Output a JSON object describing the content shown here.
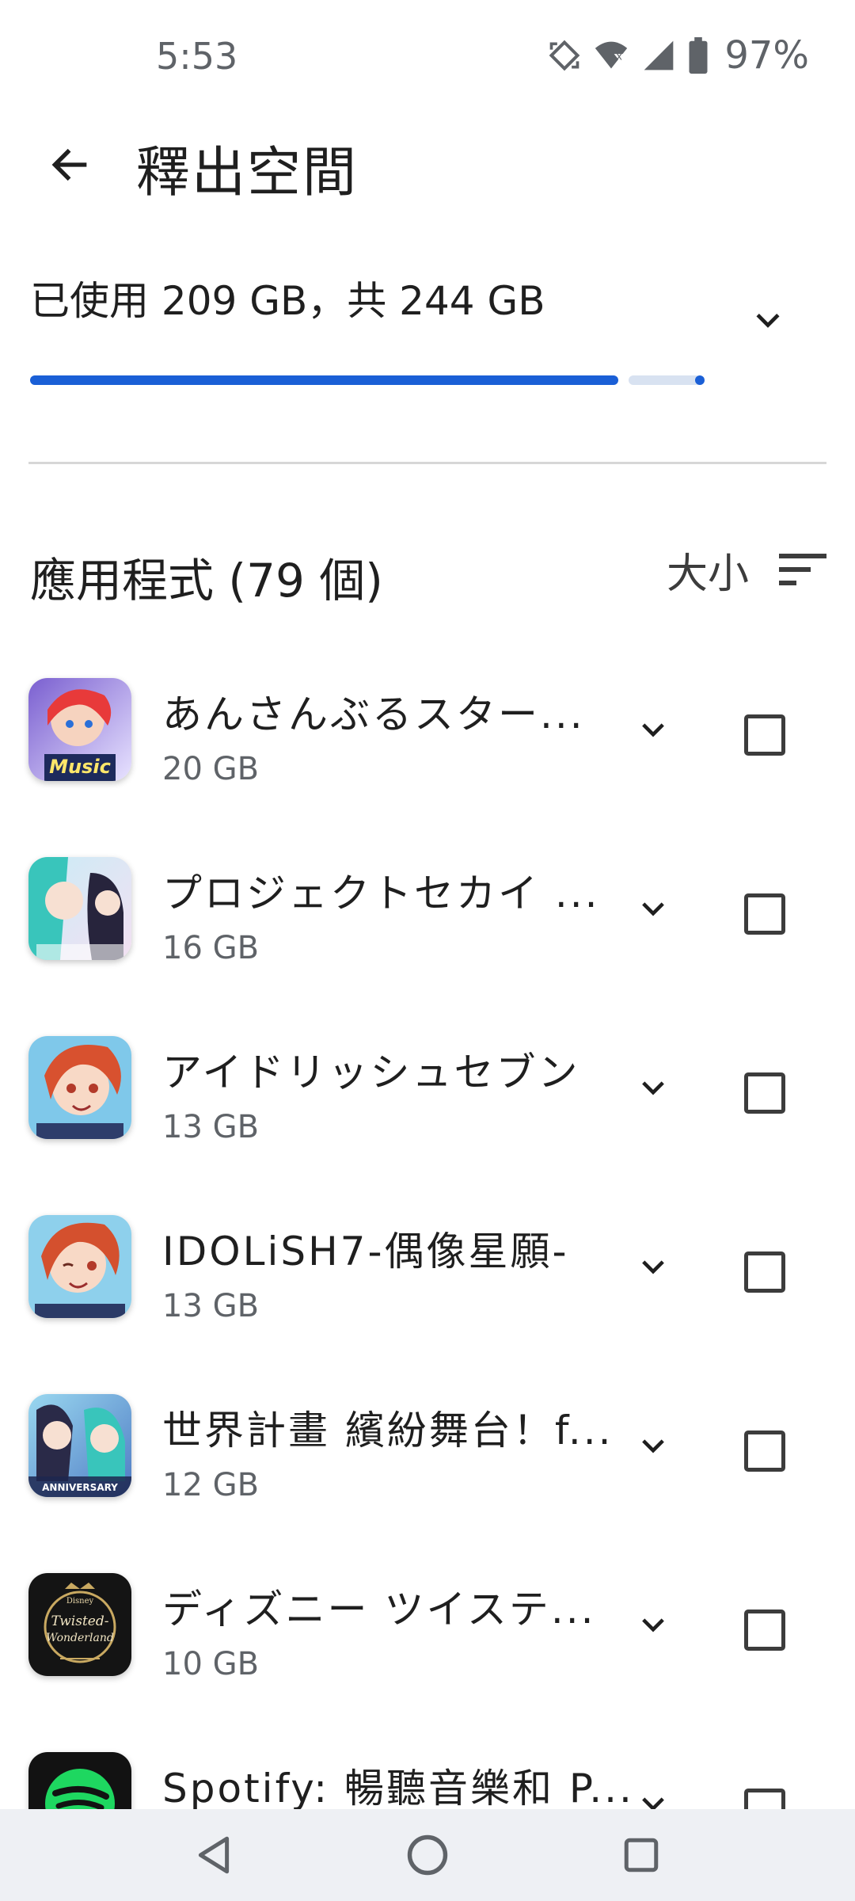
{
  "status_bar": {
    "time": "5:53",
    "battery_percent": "97%",
    "icons": [
      "auto-rotate-icon",
      "wifi-icon",
      "cell-signal-icon",
      "battery-icon"
    ]
  },
  "app_bar": {
    "title": "釋出空間",
    "back_icon": "back-arrow-icon"
  },
  "storage": {
    "summary": "已使用 209 GB，共 244 GB",
    "used_fraction": 0.856,
    "accent_color": "#1a5fd6"
  },
  "apps_section": {
    "header": "應用程式 (79 個)",
    "sort_label": "大小",
    "sort_icon": "sort-icon"
  },
  "apps": [
    {
      "name": "あんさんぶるスター...",
      "size": "20 GB",
      "icon": "ensemble-stars-icon"
    },
    {
      "name": "プロジェクトセカイ ...",
      "size": "16 GB",
      "icon": "project-sekai-icon"
    },
    {
      "name": "アイドリッシュセブン",
      "size": "13 GB",
      "icon": "idolish7-jp-icon"
    },
    {
      "name": "IDOLiSH7-偶像星願-",
      "size": "13 GB",
      "icon": "idolish7-tw-icon"
    },
    {
      "name": "世界計畫 繽紛舞台！f...",
      "size": "12 GB",
      "icon": "project-sekai-tw-icon"
    },
    {
      "name": "ディズニー ツイステ...",
      "size": "10 GB",
      "icon": "twisted-wonderland-icon"
    },
    {
      "name": "Spotify: 暢聽音樂和 P...",
      "size": "",
      "icon": "spotify-icon"
    }
  ],
  "icon_text": {
    "music_badge": "Music",
    "anniversary_badge": "ANNIVERSARY",
    "twisted_line1": "Twisted-",
    "twisted_line2": "Wonderland",
    "disney_mark": "Disney"
  },
  "nav_bar": {
    "back": "nav-back-icon",
    "home": "nav-home-icon",
    "recents": "nav-recents-icon"
  }
}
